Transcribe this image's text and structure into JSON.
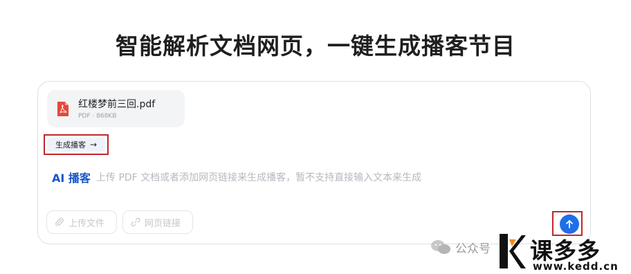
{
  "page": {
    "title": "智能解析文档网页，一键生成播客节目"
  },
  "file": {
    "name": "红楼梦前三回.pdf",
    "meta": "PDF · 868KB",
    "icon": "pdf-file-icon"
  },
  "actions": {
    "generate_label": "生成播客",
    "generate_icon": "arrow-right-icon",
    "send_icon": "arrow-up-icon"
  },
  "composer": {
    "ai_label": "AI 播客",
    "placeholder": "上传 PDF 文档或者添加网页链接来生成播客，暂不支持直接输入文本来生成",
    "upload_label": "上传文件",
    "upload_icon": "paperclip-icon",
    "link_label": "网页链接",
    "link_icon": "link-icon"
  },
  "watermark": {
    "text": "公众号",
    "brand": "课多多",
    "url": "www.kedd.cn"
  },
  "colors": {
    "accent": "#1f6fe8",
    "ai_label": "#1a56c8",
    "highlight_box": "#c0272d",
    "pdf_red": "#e5483b"
  }
}
